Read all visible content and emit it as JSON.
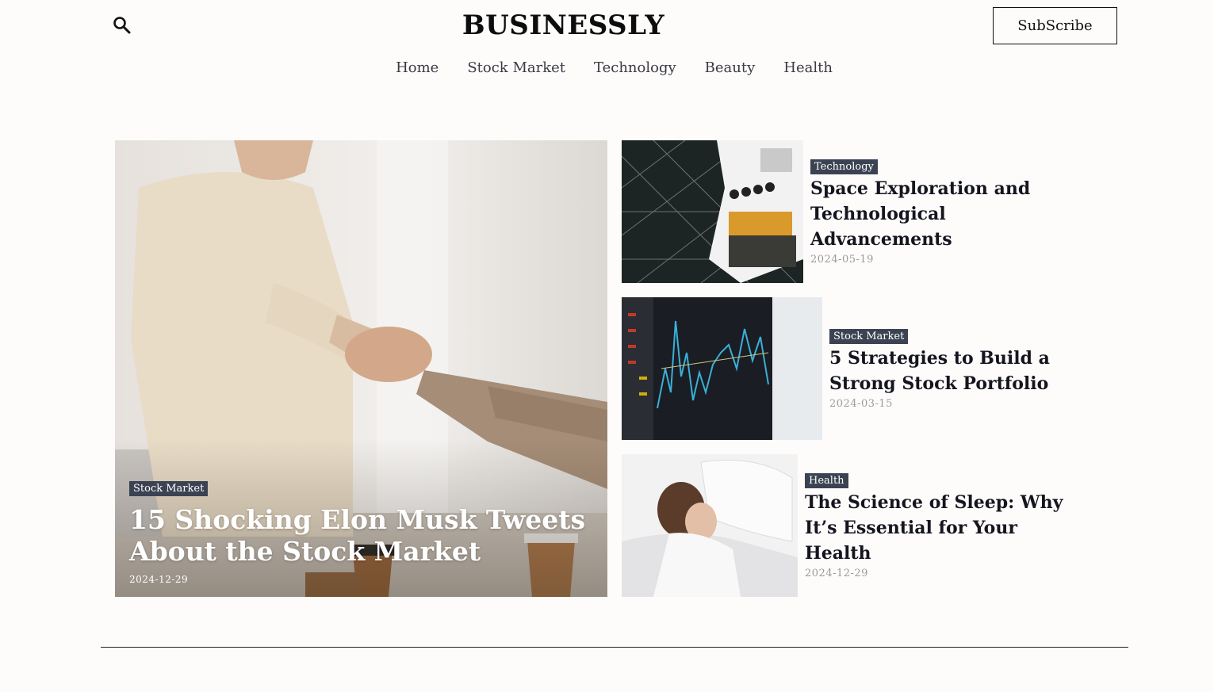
{
  "header": {
    "brand": "BUSINESSLY",
    "subscribe_label": "SubScribe",
    "search_icon": "search-icon"
  },
  "nav": {
    "items": [
      {
        "label": "Home"
      },
      {
        "label": "Stock Market"
      },
      {
        "label": "Technology"
      },
      {
        "label": "Beauty"
      },
      {
        "label": "Health"
      }
    ]
  },
  "hero": {
    "tag": "Stock Market",
    "title": "15 Shocking Elon Musk Tweets About the Stock Market",
    "date": "2024-12-29"
  },
  "side_posts": [
    {
      "tag": "Technology",
      "title": "Space Exploration and Technological Advancements",
      "date": "2024-05-19"
    },
    {
      "tag": "Stock Market",
      "title": "5 Strategies to Build a Strong Stock Portfolio",
      "date": "2024-03-15"
    },
    {
      "tag": "Health",
      "title": "The Science of Sleep: Why It’s Essential for Your Health",
      "date": "2024-12-29"
    }
  ],
  "colors": {
    "background": "#fdfcfb",
    "tag_bg": "#3b4353",
    "text": "#111111",
    "date": "#9a9a9a"
  }
}
